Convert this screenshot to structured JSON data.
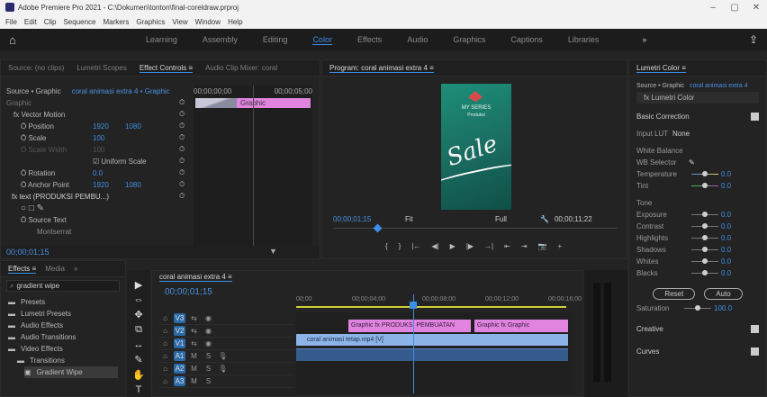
{
  "window": {
    "title": "Adobe Premiere Pro 2021 - C:\\Dokumen\\tonton\\final-coreldraw.prproj",
    "controls": {
      "minimize": "–",
      "maximize": "▢",
      "close": "✕"
    }
  },
  "menu": [
    "File",
    "Edit",
    "Clip",
    "Sequence",
    "Markers",
    "Graphics",
    "View",
    "Window",
    "Help"
  ],
  "workspaces": {
    "home": "⌂",
    "items": [
      "Learning",
      "Assembly",
      "Editing",
      "Color",
      "Effects",
      "Audio",
      "Graphics",
      "Captions",
      "Libraries"
    ],
    "active": "Color",
    "overflow": "»",
    "share": "⇪"
  },
  "effect_controls": {
    "tabs": [
      "Source: (no clips)",
      "Lumetri Scopes",
      "Effect Controls ≡",
      "Audio Clip Mixer: coral"
    ],
    "active_tab": "Effect Controls ≡",
    "source_label": "Source • Graphic",
    "source_seq": "coral animasi extra 4 • Graphic",
    "timecode_start": "00;00;00;00",
    "timecode_end": "00;00;05;00",
    "clip_label": "Graphic",
    "section_header": "Graphic",
    "rows": [
      {
        "label": "fx Vector Motion",
        "val1": "",
        "val2": ""
      },
      {
        "label": "Ö Position",
        "val1": "1920",
        "val2": "1080"
      },
      {
        "label": "Ö Scale",
        "val1": "100",
        "val2": ""
      },
      {
        "label": "Ö Scale Width",
        "val1": "100",
        "val2": ""
      },
      {
        "label": "",
        "val1": "☑ Uniform Scale",
        "val2": ""
      },
      {
        "label": "Ö Rotation",
        "val1": "0.0",
        "val2": ""
      },
      {
        "label": "Ö Anchor Point",
        "val1": "1920",
        "val2": "1080"
      },
      {
        "label": "fx text (PRODUKSI PEMBU...)",
        "val1": "",
        "val2": ""
      },
      {
        "label": "○ □ ✎",
        "val1": "",
        "val2": ""
      },
      {
        "label": "Ö Source Text",
        "val1": "",
        "val2": ""
      },
      {
        "label": "Montserrat",
        "val1": "",
        "val2": ""
      }
    ],
    "footer_timecode": "00;00;01;15"
  },
  "program_monitor": {
    "tab": "Program: coral animasi extra 4 ≡",
    "timecode": "00;00;01;15",
    "fit": "Fit",
    "quality": "Full",
    "duration": "00;00;11;22",
    "artwork": {
      "brand": "MY SERIES",
      "subtitle": "Produksi",
      "script": "Sale"
    },
    "transport": [
      "{",
      "}",
      "|←",
      "◀|",
      "▶",
      "|▶",
      "→|",
      "⇤",
      "⇥",
      "📷",
      "+"
    ]
  },
  "project": {
    "tabs": [
      "Effects ≡",
      "Media",
      "»"
    ],
    "search": "gradient wipe",
    "items": [
      "Presets",
      "Lumetri Presets",
      "Audio Effects",
      "Audio Transitions",
      "Video Effects",
      "Transitions",
      "Gradient Wipe"
    ]
  },
  "tools": [
    "▶",
    "⇔",
    "✥",
    "⧉",
    "↔",
    "✎",
    "✋",
    "T"
  ],
  "timeline": {
    "tab": "coral animasi extra 4 ≡",
    "timecode": "00;00;01;15",
    "ruler": [
      "00;00",
      "00;00;04;00",
      "00;00;08;00",
      "00;00;12;00",
      "00;00;16;00"
    ],
    "tracks_video": [
      "V3",
      "V2",
      "V1"
    ],
    "tracks_audio": [
      "A1",
      "A2",
      "A3"
    ],
    "clips": {
      "graphic1": "Graphic  fx  PRODUKSI PEMBUATAN",
      "graphic2": "Graphic  fx  Graphic",
      "video1": "coral animasi tetap.mp4 [V]",
      "audio1": ""
    }
  },
  "lumetri": {
    "tab": "Lumetri Color ≡",
    "source": "Source • Graphic",
    "seq": "coral animasi extra 4",
    "effect": "fx Lumetri Color",
    "basic": "Basic Correction",
    "input_lut": "Input LUT",
    "input_lut_val": "None",
    "white_balance": "White Balance",
    "wb_selector": "WB Selector",
    "temperature": "Temperature",
    "temperature_val": "0.0",
    "tint": "Tint",
    "tint_val": "0.0",
    "tone": "Tone",
    "tone_rows": [
      {
        "label": "Exposure",
        "val": "0.0"
      },
      {
        "label": "Contrast",
        "val": "0.0"
      },
      {
        "label": "Highlights",
        "val": "0.0"
      },
      {
        "label": "Shadows",
        "val": "0.0"
      },
      {
        "label": "Whites",
        "val": "0.0"
      },
      {
        "label": "Blacks",
        "val": "0.0"
      }
    ],
    "reset": "Reset",
    "auto": "Auto",
    "saturation": "Saturation",
    "saturation_val": "100.0",
    "creative": "Creative",
    "curves": "Curves"
  },
  "colors": {
    "accent": "#3c8ee8",
    "graphic_clip": "#e084e0",
    "video_clip": "#8cb4e8",
    "audio_clip": "#355c8c",
    "playhead": "#3c8ee8"
  }
}
